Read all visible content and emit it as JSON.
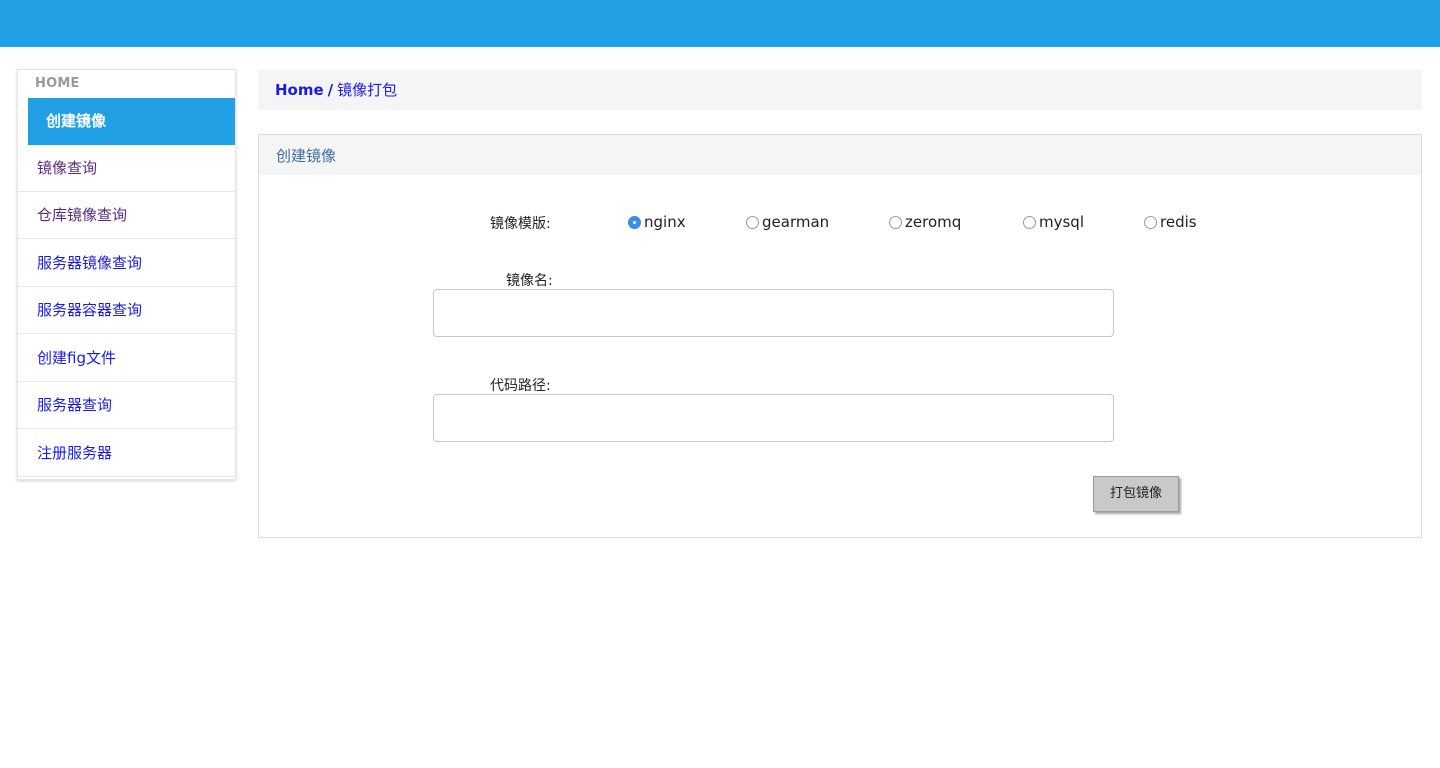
{
  "header": {
    "color": "#22a0e6"
  },
  "sidebar": {
    "header": "HOME",
    "items": [
      {
        "label": "创建镜像",
        "state": "active"
      },
      {
        "label": "镜像查询",
        "state": "visited"
      },
      {
        "label": "仓库镜像查询",
        "state": "visited"
      },
      {
        "label": "服务器镜像查询",
        "state": "link"
      },
      {
        "label": "服务器容器查询",
        "state": "link"
      },
      {
        "label": "创建fig文件",
        "state": "link"
      },
      {
        "label": "服务器查询",
        "state": "link"
      },
      {
        "label": "注册服务器",
        "state": "link"
      }
    ]
  },
  "breadcrumb": {
    "home": "Home",
    "separator": "/",
    "current": "镜像打包"
  },
  "panel": {
    "title": "创建镜像"
  },
  "form": {
    "template_label": "镜像模版:",
    "template_options": [
      {
        "label": "nginx",
        "checked": true
      },
      {
        "label": "gearman",
        "checked": false
      },
      {
        "label": "zeromq",
        "checked": false
      },
      {
        "label": "mysql",
        "checked": false
      },
      {
        "label": "redis",
        "checked": false
      }
    ],
    "name_label": "镜像名:",
    "name_value": "",
    "path_label": "代码路径:",
    "path_value": "",
    "submit_label": "打包镜像"
  }
}
